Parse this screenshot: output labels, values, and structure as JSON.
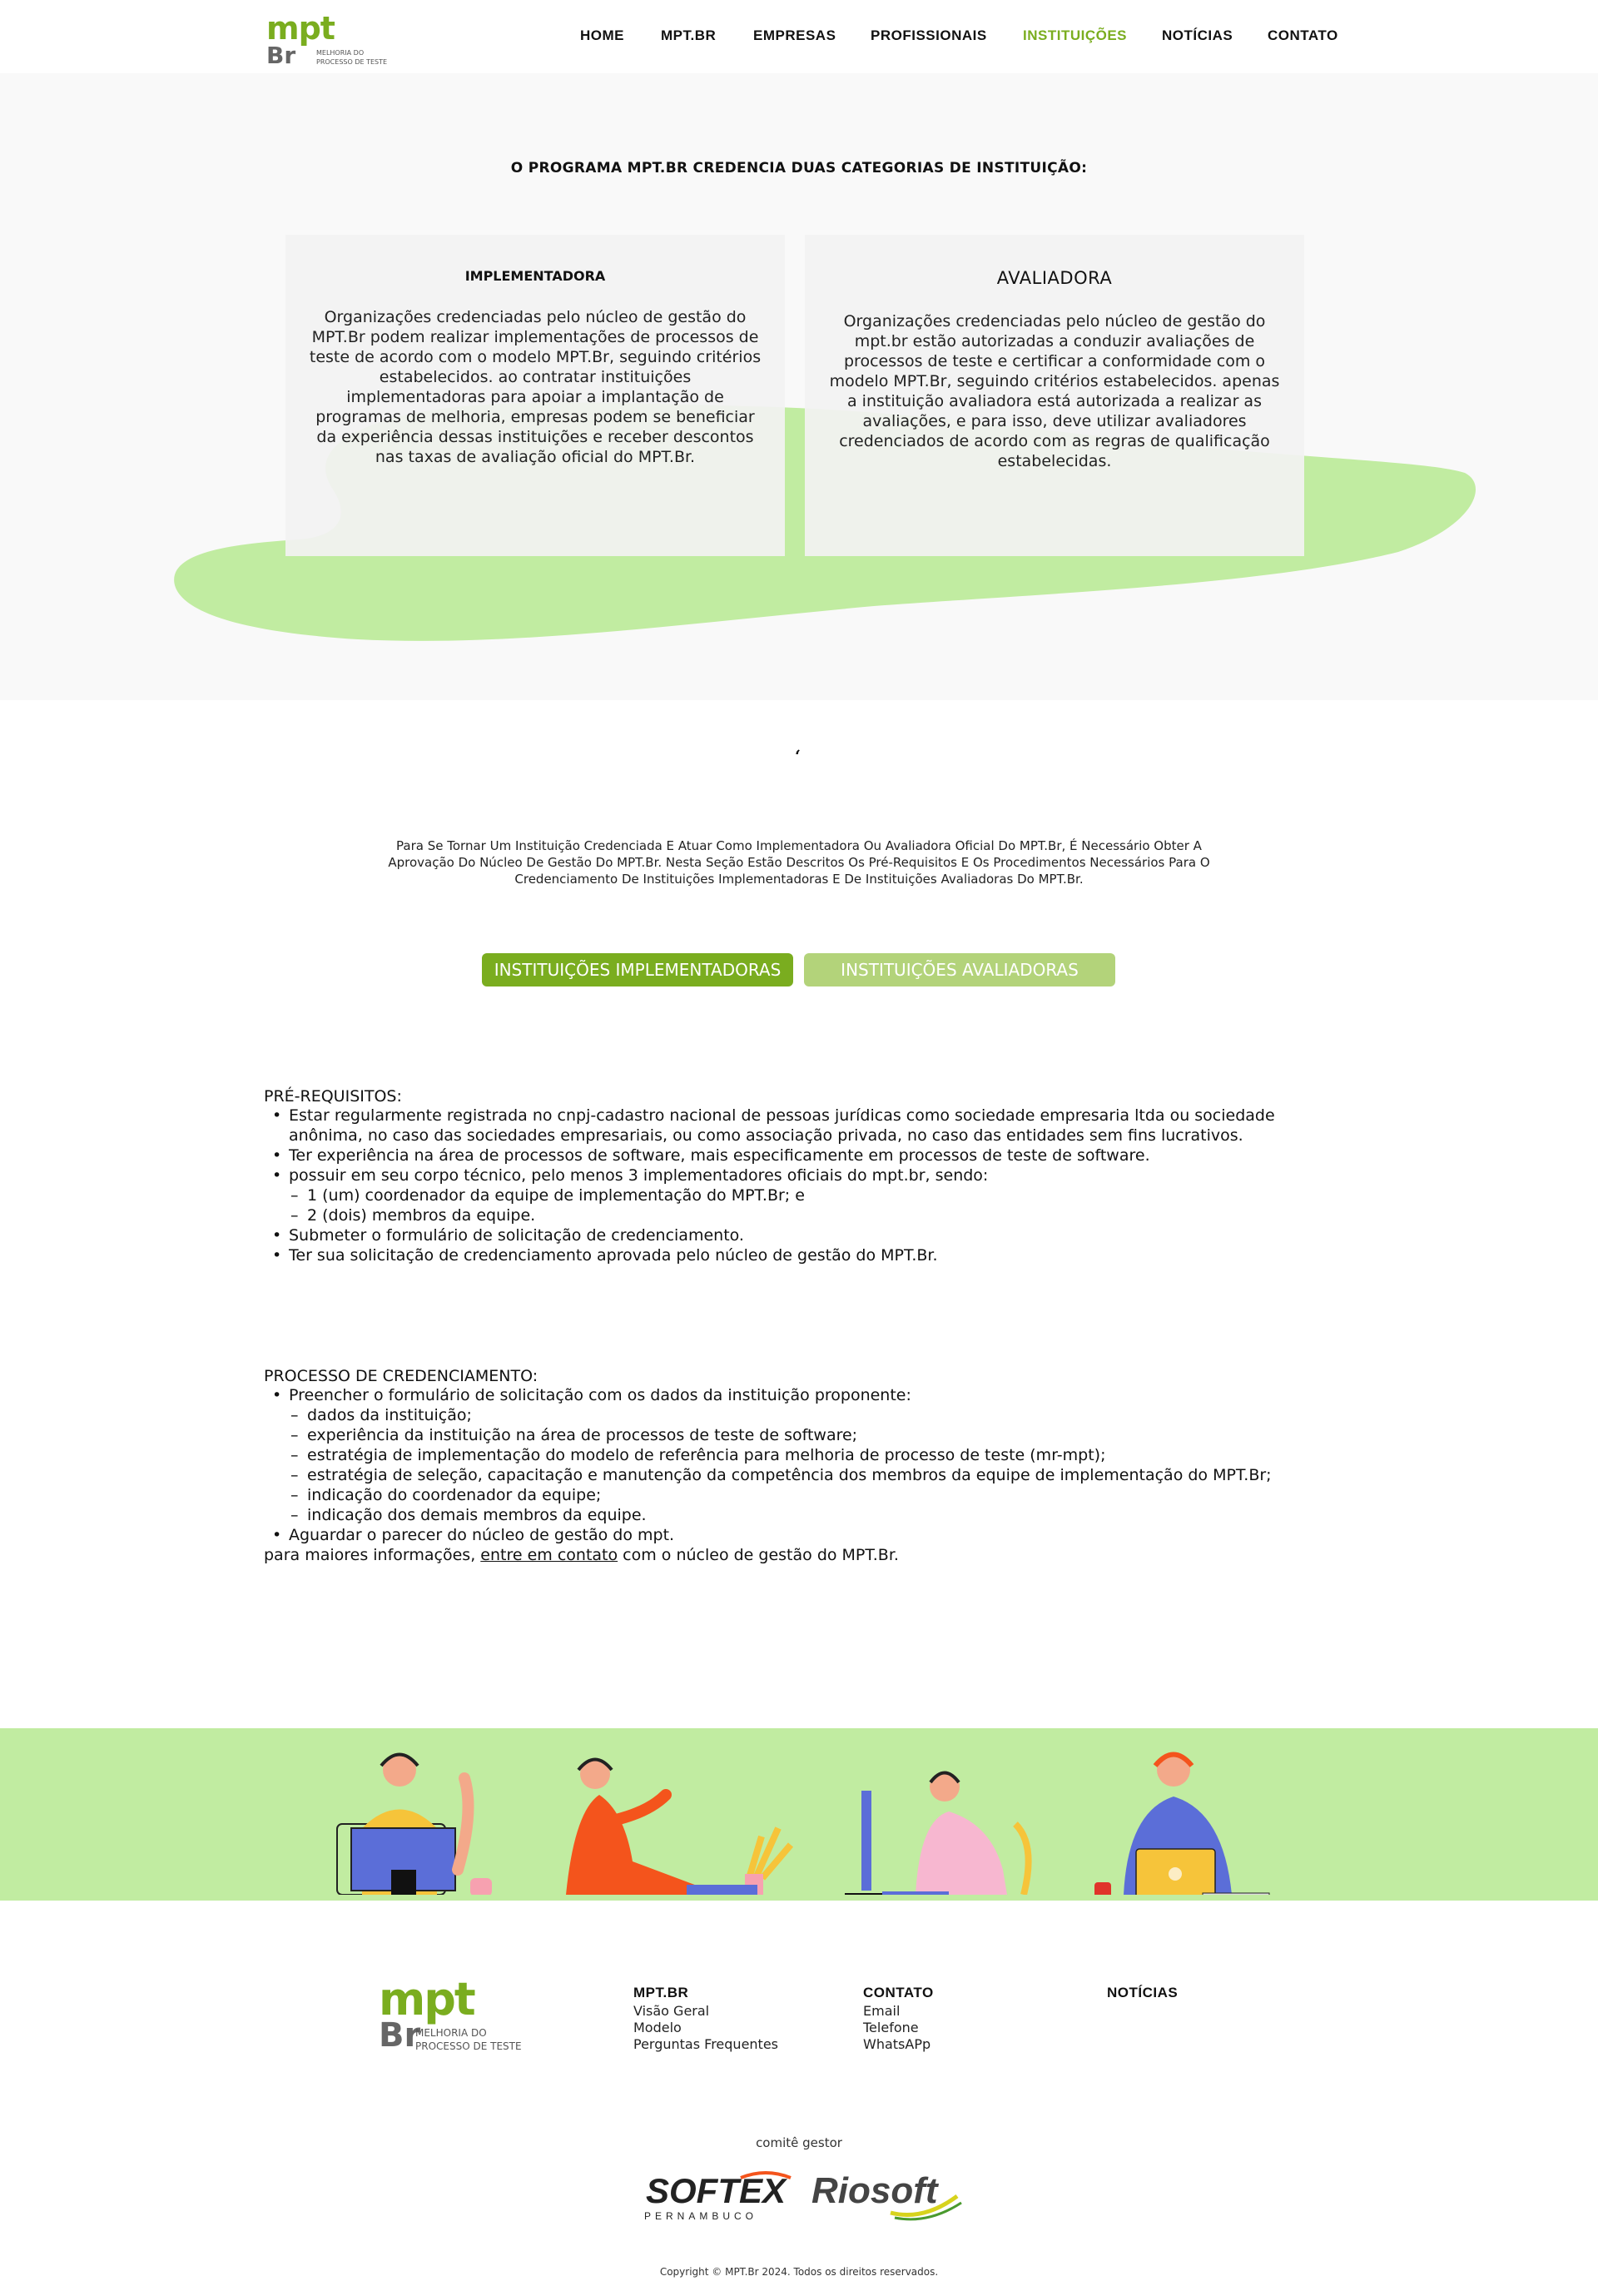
{
  "logo": {
    "mpt": "mpt",
    "br": "Br",
    "tagline": "MELHORIA DO\nPROCESSO DE TESTE"
  },
  "nav": {
    "items": [
      "HOME",
      "MPT.BR",
      "EMPRESAS",
      "PROFISSIONAIS",
      "INSTITUIÇÕES",
      "NOTÍCIAS",
      "CONTATO"
    ],
    "active": "INSTITUIÇÕES"
  },
  "intro": {
    "heading": "O PROGRAMA MPT.BR CREDENCIA DUAS CATEGORIAS DE INSTITUIÇÃO:",
    "cards": [
      {
        "title": "IMPLEMENTADORA",
        "text": "Organizações credenciadas pelo núcleo de gestão do MPT.Br podem realizar implementações de processos de teste de acordo com o modelo MPT.Br, seguindo critérios estabelecidos. ao contratar instituições implementadoras para apoiar a implantação de programas de melhoria, empresas podem se beneficiar da experiência dessas instituições e receber descontos nas taxas de avaliação oficial do MPT.Br."
      },
      {
        "title": "AVALIADORA",
        "text": "Organizações credenciadas pelo núcleo de gestão do mpt.br estão autorizadas a conduzir avaliações de processos de teste e certificar a conformidade com o modelo MPT.Br, seguindo critérios estabelecidos. apenas a instituição avaliadora está autorizada a realizar as avaliações, e para isso, deve utilizar avaliadores credenciados de acordo com as regras de qualificação estabelecidas."
      }
    ]
  },
  "quote_mark": "‘",
  "lead": "Para Se Tornar Um Instituição Credenciada E Atuar Como Implementadora Ou Avaliadora Oficial Do MPT.Br, É Necessário Obter A Aprovação Do Núcleo De Gestão Do MPT.Br. Nesta Seção Estão Descritos Os Pré-Requisitos E Os Procedimentos Necessários Para O Credenciamento De Instituições Implementadoras E De Instituições Avaliadoras Do MPT.Br.",
  "tabs": {
    "implementadoras": "INSTITUIÇÕES IMPLEMENTADORAS",
    "avaliadoras": "INSTITUIÇÕES AVALIADORAS",
    "active": "implementadoras"
  },
  "prerequisites": {
    "title": "PRÉ-REQUISITOS:",
    "items": [
      "Estar regularmente registrada no cnpj-cadastro nacional de pessoas jurídicas como sociedade empresaria ltda ou sociedade anônima, no caso das sociedades empresariais, ou como associação privada, no caso das entidades sem fins lucrativos.",
      "Ter experiência na área de processos de software, mais especificamente em processos de teste de software.",
      "possuir em seu corpo técnico, pelo menos 3 implementadores oficiais do mpt.br, sendo:",
      "1 (um) coordenador da equipe de implementação do MPT.Br; e",
      "2 (dois) membros da equipe.",
      "Submeter o formulário de solicitação de credenciamento.",
      "Ter sua solicitação de credenciamento aprovada pelo núcleo de gestão do MPT.Br."
    ]
  },
  "process": {
    "title": "PROCESSO DE CREDENCIAMENTO:",
    "items": [
      "Preencher o formulário de solicitação com os dados da instituição proponente:",
      "dados da instituição;",
      "experiência da instituição na área de processos de teste de software;",
      "estratégia de implementação do modelo de referência para melhoria de processo de teste (mr-mpt);",
      "estratégia de seleção, capacitação e manutenção da competência dos membros da equipe de implementação do MPT.Br;",
      "indicação do coordenador da equipe;",
      "indicação dos demais membros da equipe.",
      "Aguardar o parecer do núcleo de gestão do mpt."
    ],
    "more_prefix": "para maiores informações,",
    "more_link": "entre em contato",
    "more_suffix": "com o núcleo de gestão do MPT.Br."
  },
  "footer": {
    "columns": [
      {
        "title": "MPT.BR",
        "links": [
          "Visão Geral",
          "Modelo",
          "Perguntas Frequentes"
        ]
      },
      {
        "title": "CONTATO",
        "links": [
          "Email",
          "Telefone",
          "WhatsAPp"
        ]
      },
      {
        "title": "NOTÍCIAS",
        "links": []
      }
    ],
    "comite": "comitê gestor",
    "sponsors": {
      "softex": "SOFTEX",
      "softex_sub": "PERNAMBUCO",
      "riosoft": "Riosoft"
    },
    "copyright": "Copyright © MPT.Br 2024. Todos os direitos reservados."
  },
  "colors": {
    "brand_green": "#7aad1f",
    "light_green": "#b3d37a",
    "band_green": "#c1eca1",
    "blob_green": "#c1eca1"
  }
}
